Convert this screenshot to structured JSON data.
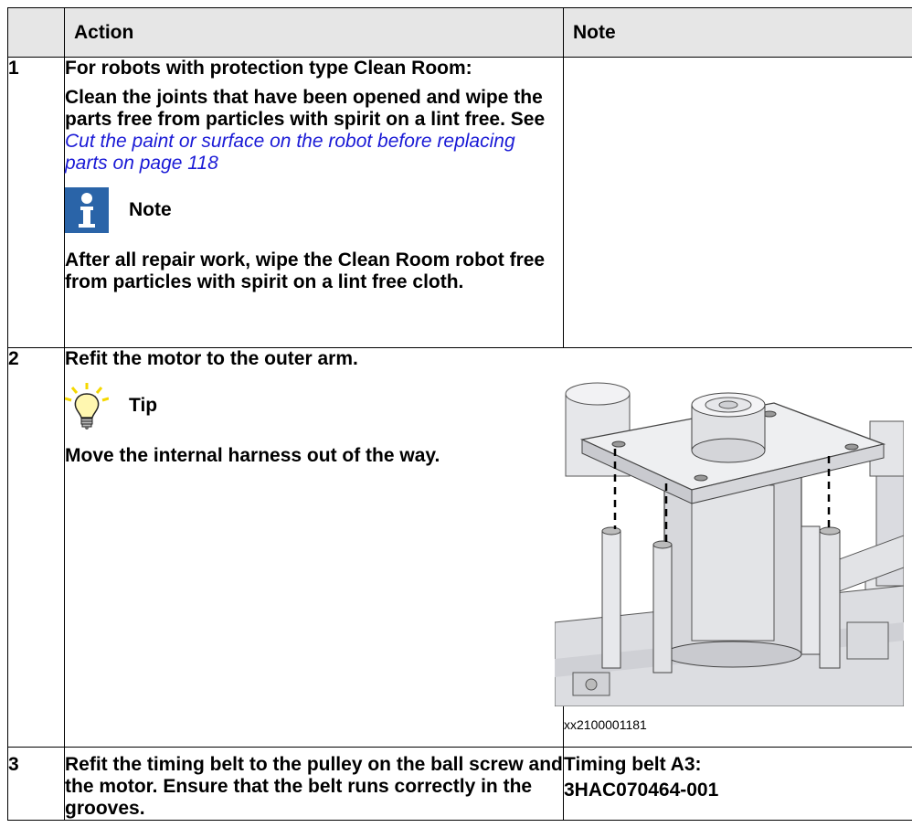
{
  "table": {
    "headers": [
      "",
      "Action",
      "Note"
    ],
    "rows": [
      {
        "num": "1",
        "para1": "For robots with protection type Clean Room:",
        "para2_pre": "Clean the joints that have been opened and wipe the parts free from particles with spirit on a lint free. See ",
        "para2_link": "Cut the paint or surface on the robot before replacing parts on page 118",
        "callout_label": "Note",
        "callout_icon": "info-icon",
        "para3": "After all repair work, wipe the Clean Room robot free from particles with spirit on a lint free cloth.",
        "note": ""
      },
      {
        "num": "2",
        "para1": "Refit the motor to the outer arm.",
        "callout_label": "Tip",
        "callout_icon": "lightbulb-icon",
        "para2": "Move the internal harness out of the way.",
        "figure_id": "xx2100001181"
      },
      {
        "num": "3",
        "para1": "Refit the timing belt to the pulley on the ball screw and the motor. Ensure that the belt runs correctly in the grooves.",
        "note_line1": "Timing belt A3:",
        "note_line2": "3HAC070464-001"
      }
    ]
  },
  "colors": {
    "header_bg": "#e6e6e6",
    "link": "#1a1ad6",
    "info_icon_bg": "#2a64a8",
    "tip_bulb": "#f5d800"
  }
}
